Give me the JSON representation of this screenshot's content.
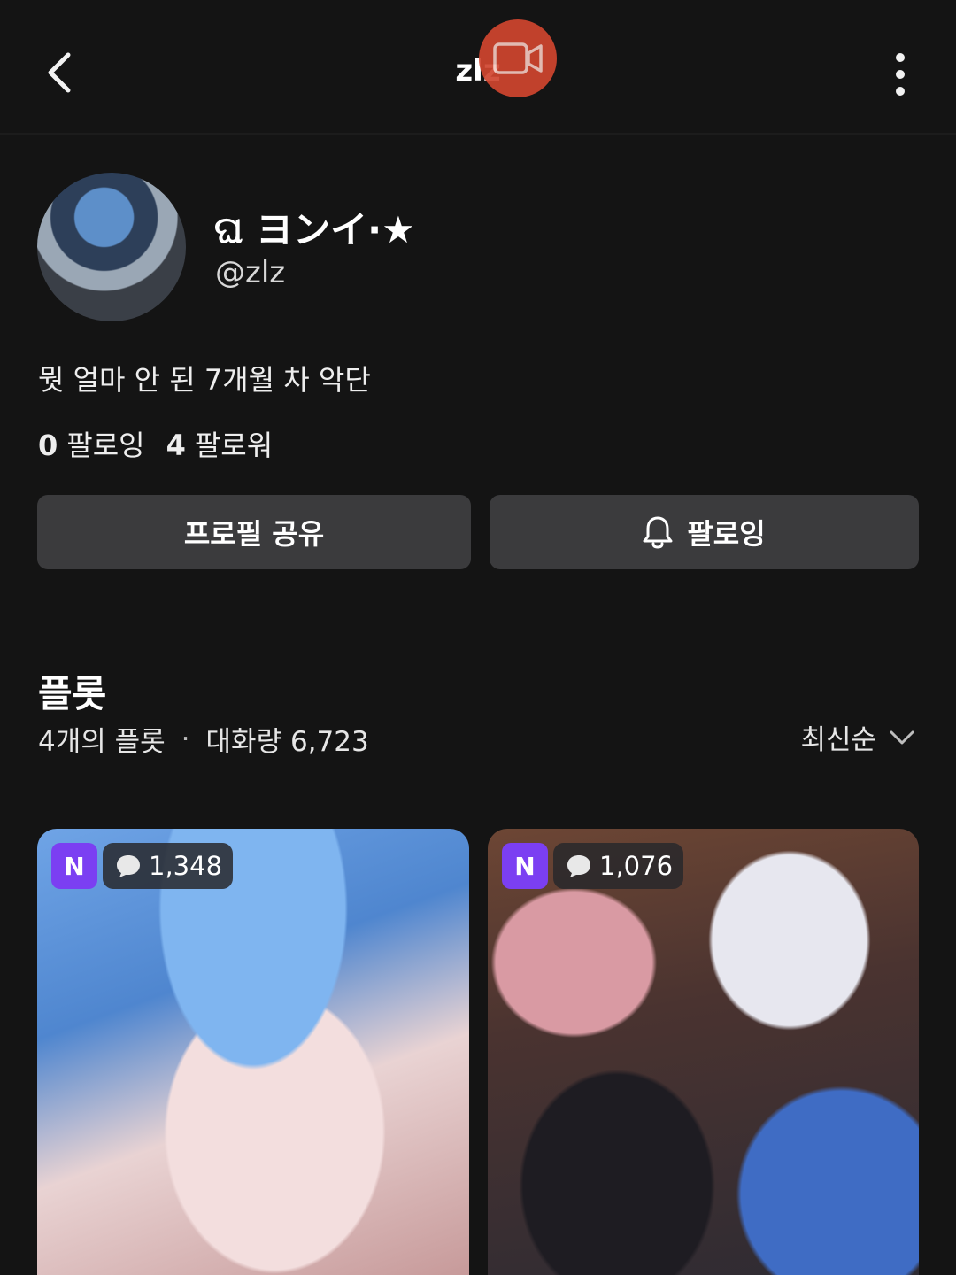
{
  "header": {
    "title": "zlz",
    "back_icon": "chevron-left-icon",
    "record_icon": "video-camera-icon",
    "more_icon": "vertical-dots-icon"
  },
  "profile": {
    "display_name": "ଘ ヨンイ·★",
    "handle": "@zlz",
    "bio": "뭣 얼마 안 된 7개월 차 악단",
    "following_count": "0",
    "following_label": "팔로잉",
    "followers_count": "4",
    "followers_label": "팔로워"
  },
  "actions": {
    "share_label": "프로필 공유",
    "follow_label": "팔로잉",
    "follow_icon": "bell-icon"
  },
  "plots": {
    "title": "플롯",
    "count_text": "4개의 플롯",
    "separator": "·",
    "conversation_text": "대화량 6,723",
    "sort_label": "최신순",
    "cards": [
      {
        "badge": "N",
        "count": "1,348"
      },
      {
        "badge": "N",
        "count": "1,076"
      }
    ]
  },
  "colors": {
    "background": "#141414",
    "button": "#3b3b3d",
    "badge_purple": "#7b3ff2",
    "record_red": "#d0452f"
  }
}
